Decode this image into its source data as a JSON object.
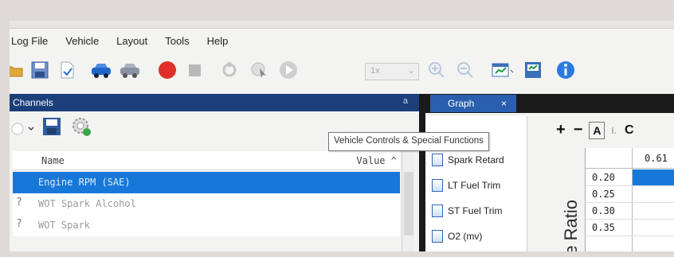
{
  "menu": [
    "Log File",
    "Vehicle",
    "Layout",
    "Tools",
    "Help"
  ],
  "toolbar": {
    "zoom_value": "1x",
    "icons": [
      "open-folder-icon",
      "save-icon",
      "document-icon",
      "vehicle-connect-icon",
      "vehicle-disconnect-icon",
      "record-icon",
      "stop-icon",
      "rewind-icon",
      "playback-icon",
      "play-icon",
      "zoom-in-icon",
      "zoom-out-icon",
      "graph-layout-icon",
      "save-layout-icon",
      "info-icon"
    ]
  },
  "channels": {
    "title": "Channels",
    "pin_label": "a",
    "columns": {
      "name": "Name",
      "value": "Value"
    },
    "rows": [
      {
        "name": "Engine RPM (SAE)",
        "selected": true,
        "icon": ""
      },
      {
        "name": "WOT Spark Alcohol",
        "selected": false,
        "icon": "?"
      },
      {
        "name": "WOT Spark",
        "selected": false,
        "icon": "?"
      }
    ]
  },
  "graph": {
    "tab_label": "Graph",
    "tooltip": "Vehicle Controls & Special Functions",
    "items": [
      "Spark Retard",
      "LT Fuel Trim",
      "ST Fuel Trim",
      "O2 (mv)"
    ],
    "controls": {
      "plus": "+",
      "minus": "−",
      "a": "A",
      "small": "I.",
      "c": "C"
    },
    "axis_label": "re Ratio",
    "top_value": "0.61",
    "rows": [
      "0.20",
      "0.25",
      "0.30",
      "0.35"
    ]
  },
  "colors": {
    "accent": "#1878d9",
    "panel_header": "#1b3f7a",
    "record": "#e0302a"
  }
}
